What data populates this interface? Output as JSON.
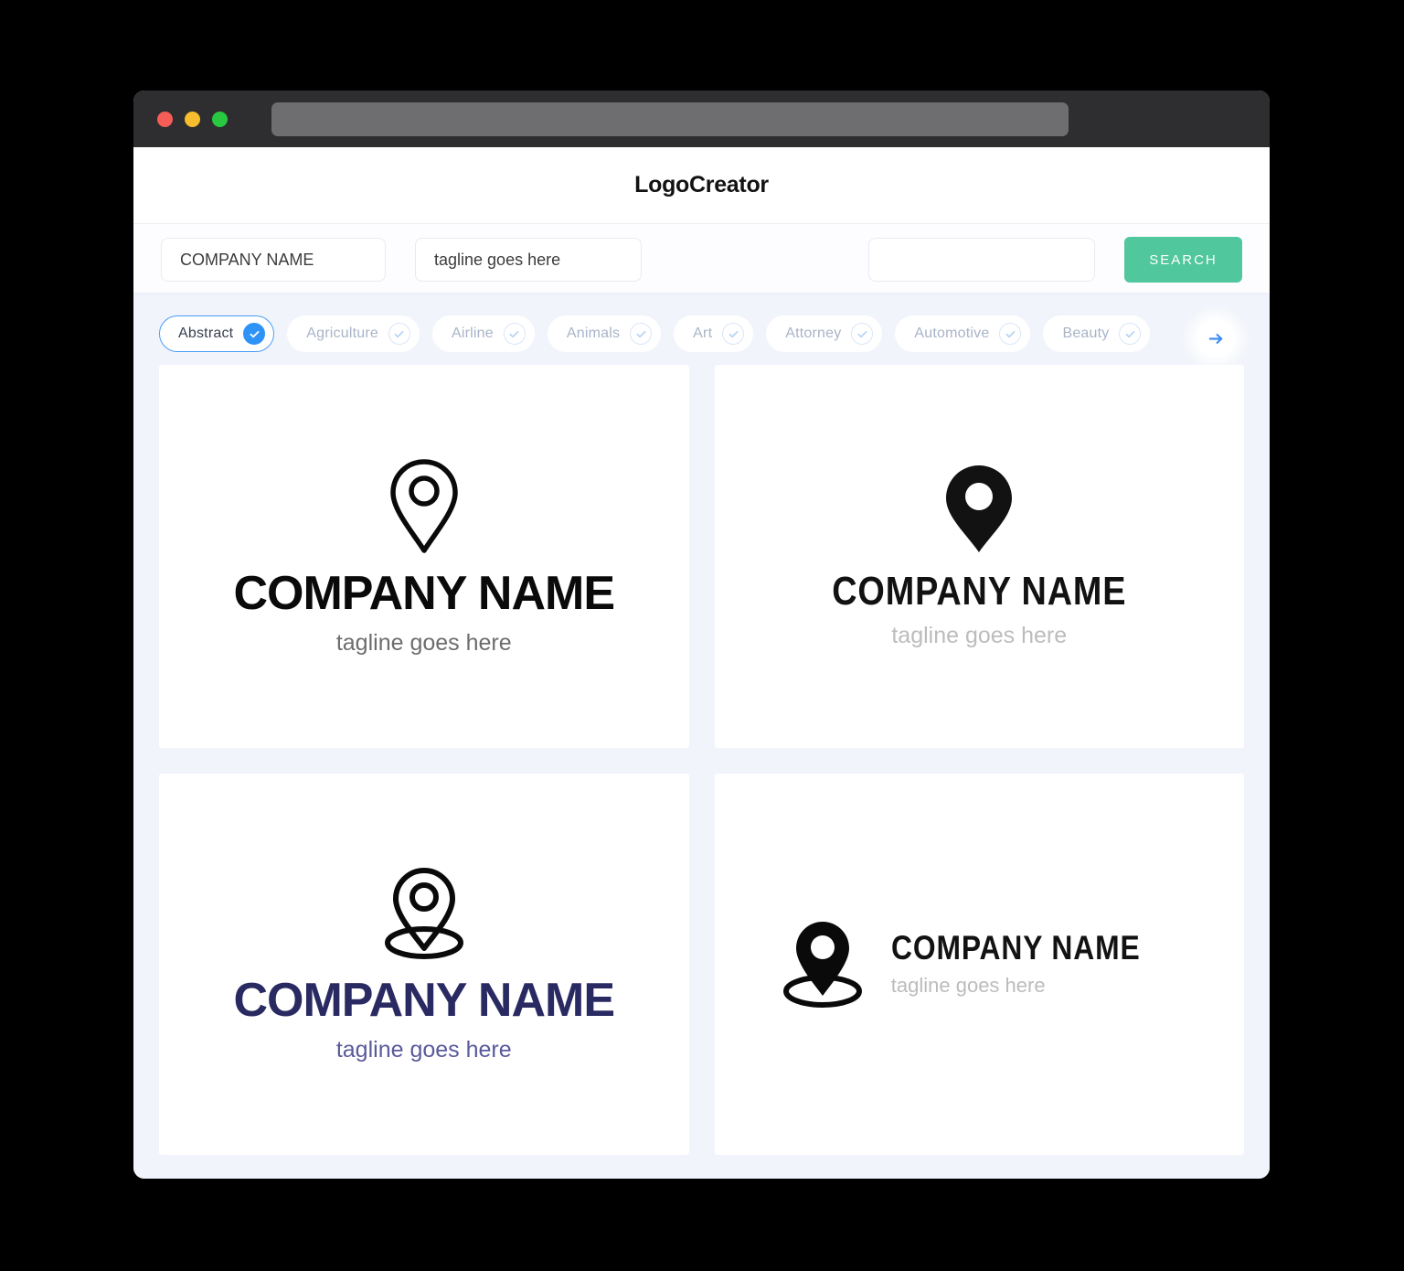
{
  "window": {
    "traffic_lights": [
      "close",
      "minimize",
      "maximize"
    ],
    "address_bar_value": ""
  },
  "header": {
    "brand": "LogoCreator"
  },
  "search": {
    "company_value": "COMPANY NAME",
    "company_placeholder": "COMPANY NAME",
    "tagline_value": "tagline goes here",
    "tagline_placeholder": "tagline goes here",
    "keyword_value": "",
    "keyword_placeholder": "",
    "button_label": "SEARCH",
    "button_color": "#50c79c"
  },
  "categories": {
    "active_color": "#2e93f7",
    "items": [
      {
        "label": "Abstract",
        "selected": true
      },
      {
        "label": "Agriculture",
        "selected": false
      },
      {
        "label": "Airline",
        "selected": false
      },
      {
        "label": "Animals",
        "selected": false
      },
      {
        "label": "Art",
        "selected": false
      },
      {
        "label": "Attorney",
        "selected": false
      },
      {
        "label": "Automotive",
        "selected": false
      },
      {
        "label": "Beauty",
        "selected": false
      }
    ],
    "next_icon": "arrow-right-icon"
  },
  "results": [
    {
      "id": "logo-1",
      "icon": "map-pin-outline-icon",
      "name": "COMPANY NAME",
      "tagline": "tagline goes here",
      "name_color": "#0a0a0a",
      "tagline_color": "#6d6d6d",
      "layout": "stacked"
    },
    {
      "id": "logo-2",
      "icon": "map-pin-solid-icon",
      "name": "COMPANY NAME",
      "tagline": "tagline goes here",
      "name_color": "#121212",
      "tagline_color": "#bcbcbc",
      "layout": "stacked"
    },
    {
      "id": "logo-3",
      "icon": "map-pin-outline-ring-icon",
      "name": "COMPANY NAME",
      "tagline": "tagline goes here",
      "name_color": "#2a2a63",
      "tagline_color": "#5a5a9c",
      "layout": "stacked"
    },
    {
      "id": "logo-4",
      "icon": "map-pin-solid-ring-icon",
      "name": "COMPANY NAME",
      "tagline": "tagline goes here",
      "name_color": "#121212",
      "tagline_color": "#bcbcbc",
      "layout": "horizontal"
    }
  ]
}
